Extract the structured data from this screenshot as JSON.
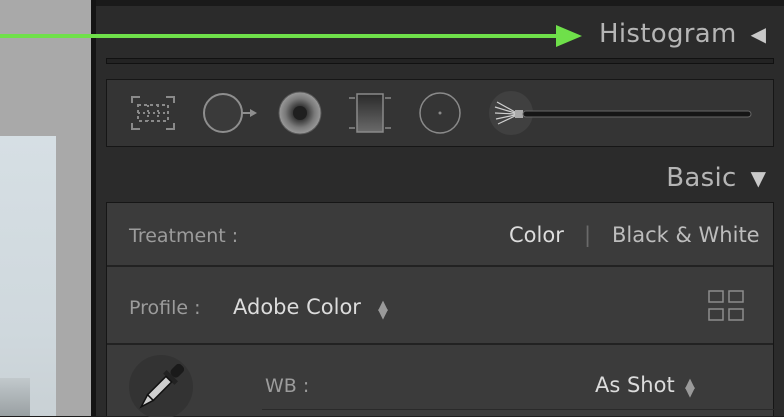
{
  "colors": {
    "accent_arrow": "#6fe04a"
  },
  "panels": {
    "histogram": {
      "title": "Histogram",
      "collapse_icon": "triangle-left-icon"
    },
    "basic": {
      "title": "Basic",
      "expand_icon": "triangle-down-icon"
    }
  },
  "toolstrip": {
    "tools": [
      {
        "name": "crop-overlay-icon"
      },
      {
        "name": "spot-removal-icon"
      },
      {
        "name": "red-eye-icon"
      },
      {
        "name": "graduated-filter-icon"
      },
      {
        "name": "radial-filter-icon"
      },
      {
        "name": "adjustment-brush-icon"
      }
    ]
  },
  "basic_panel": {
    "treatment_label": "Treatment :",
    "treatment_color": "Color",
    "treatment_separator": "|",
    "treatment_bw": "Black & White",
    "profile_label": "Profile :",
    "profile_value": "Adobe Color",
    "profile_browser_icon": "grid-icon",
    "wb_label": "WB :",
    "wb_value": "As Shot",
    "eyedropper_icon": "eyedropper-icon"
  }
}
